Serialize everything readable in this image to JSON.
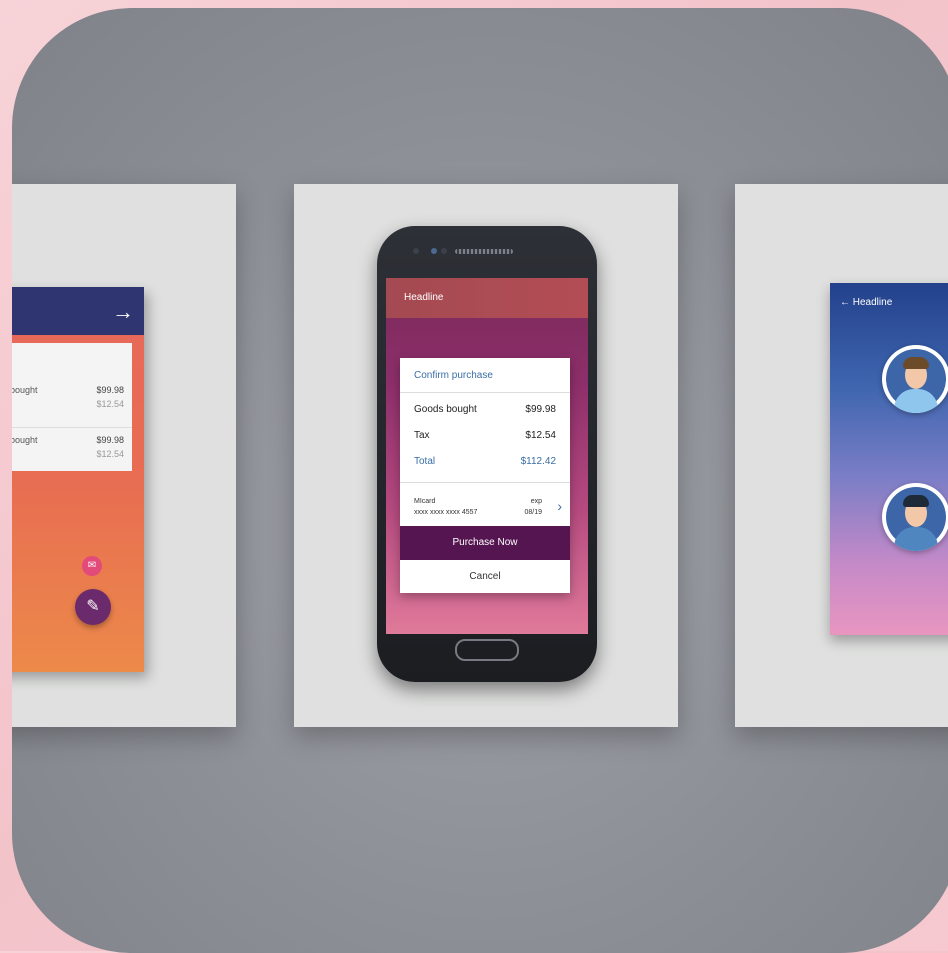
{
  "left_screen": {
    "nav_arrow": "→",
    "rows": [
      {
        "name": "ds bought",
        "price": "$99.98",
        "tax": "$12.54"
      },
      {
        "name": "ds bought",
        "price": "$99.98",
        "tax": "$12.54"
      }
    ],
    "mail_icon": "mail-icon",
    "fab_icon": "pen-icon"
  },
  "middle_screen": {
    "headline": "Headline",
    "dialog": {
      "title": "Confirm purchase",
      "goods_label": "Goods bought",
      "goods_value": "$99.98",
      "tax_label": "Tax",
      "tax_value": "$12.54",
      "total_label": "Total",
      "total_value": "$112.42",
      "card_name": "MIcard",
      "card_number": "xxxx xxxx xxxx 4557",
      "exp_label": "exp",
      "exp_value": "08/19",
      "purchase_label": "Purchase Now",
      "cancel_label": "Cancel"
    }
  },
  "right_screen": {
    "headline": "← Headline"
  },
  "colors": {
    "accent": "#551550",
    "link": "#3a6ea5",
    "left_topbar": "#2f3570"
  }
}
